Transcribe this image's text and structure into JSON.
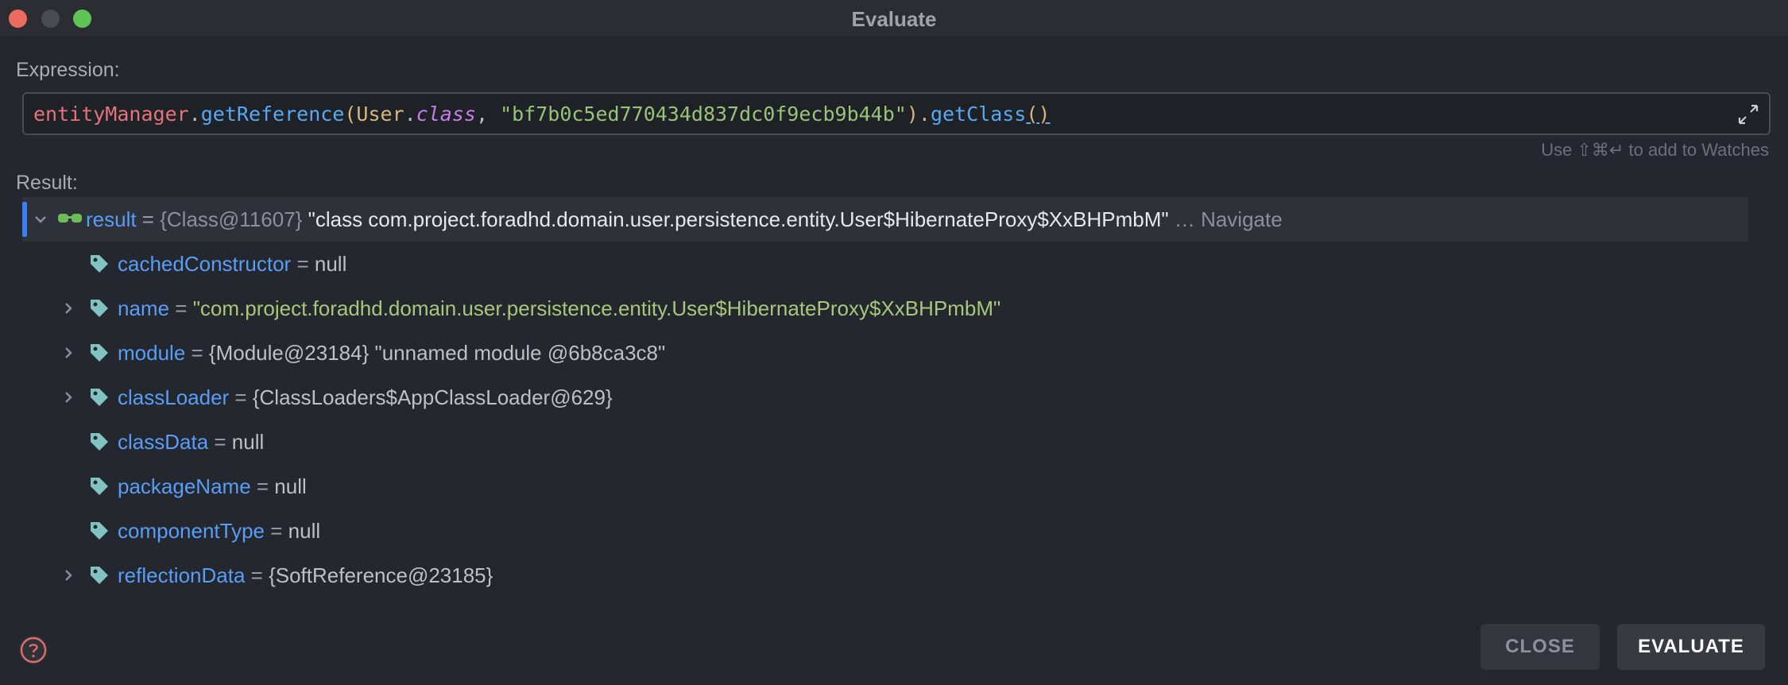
{
  "window": {
    "title": "Evaluate"
  },
  "expression": {
    "label": "Expression:",
    "tokens": {
      "t1": "entityManager",
      "t2": ".",
      "t3": "getReference",
      "t4": "(",
      "t5": "User",
      "t6": ".",
      "t7": "class",
      "t8": ", ",
      "t9": "\"bf7b0c5ed770434d837dc0f9ecb9b44b\"",
      "t10": ").",
      "t11": "getClass",
      "t12": "()"
    },
    "hint": "Use ⇧⌘↵ to add to Watches"
  },
  "result": {
    "label": "Result:",
    "root": {
      "name": "result",
      "eq": " = ",
      "type": "{Class@11607}",
      "value": " \"class com.project.foradhd.domain.user.persistence.entity.User$HibernateProxy$XxBHPmbM\"",
      "ellipsis": " … ",
      "navigate": "Navigate"
    },
    "fields": [
      {
        "name": "cachedConstructor",
        "eq": " = ",
        "value": "null"
      },
      {
        "name": "name",
        "eq": " = ",
        "value": "\"com.project.foradhd.domain.user.persistence.entity.User$HibernateProxy$XxBHPmbM\""
      },
      {
        "name": "module",
        "eq": " = ",
        "value": "{Module@23184} \"unnamed module @6b8ca3c8\""
      },
      {
        "name": "classLoader",
        "eq": " = ",
        "value": "{ClassLoaders$AppClassLoader@629}"
      },
      {
        "name": "classData",
        "eq": " = ",
        "value": "null"
      },
      {
        "name": "packageName",
        "eq": " = ",
        "value": "null"
      },
      {
        "name": "componentType",
        "eq": " = ",
        "value": "null"
      },
      {
        "name": "reflectionData",
        "eq": " = ",
        "value": "{SoftReference@23185}"
      }
    ]
  },
  "buttons": {
    "close": "CLOSE",
    "evaluate": "EVALUATE"
  },
  "icons": {
    "expand": "expand-icon",
    "tag": "field-tag-icon",
    "glasses": "watch-glasses-icon",
    "help": "help-icon",
    "chevron": "chevron-icon"
  },
  "colors": {
    "accent": "#3d7ff2",
    "field_name": "#589df6",
    "string": "#a9c77a",
    "tag": "#7fc3c3"
  }
}
